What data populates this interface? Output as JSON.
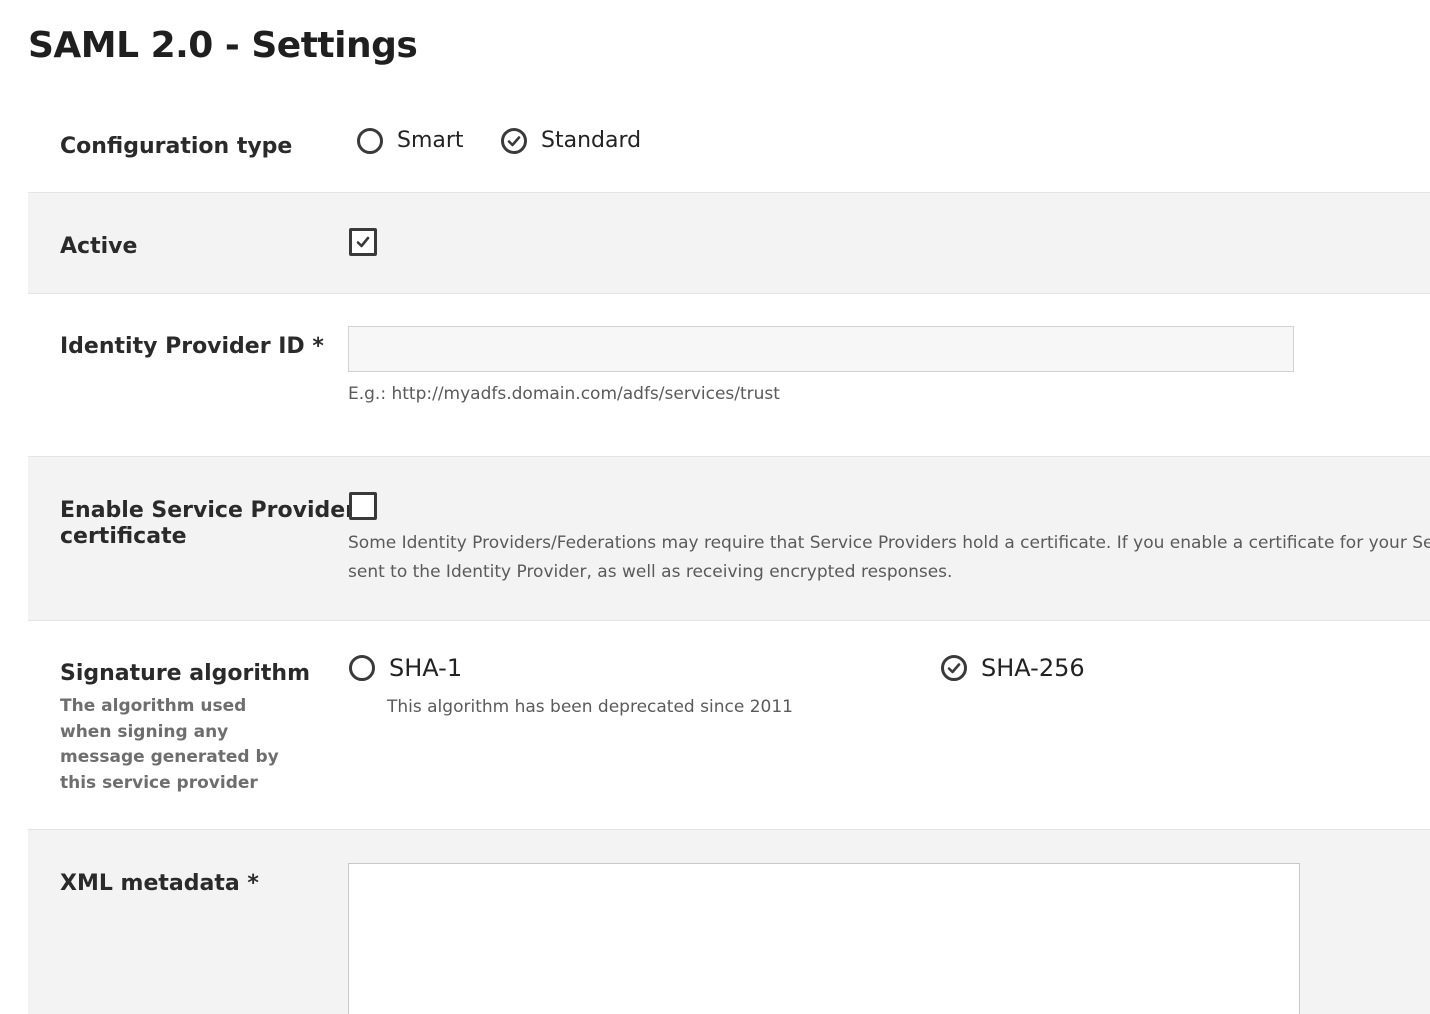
{
  "page": {
    "title": "SAML 2.0 - Settings"
  },
  "config_type": {
    "label": "Configuration type",
    "options": [
      {
        "label": "Smart",
        "checked": false
      },
      {
        "label": "Standard",
        "checked": true
      }
    ]
  },
  "active": {
    "label": "Active",
    "checked": true
  },
  "identity_provider": {
    "label": "Identity Provider ID *",
    "value": "",
    "placeholder": "",
    "hint": "E.g.: http://myadfs.domain.com/adfs/services/trust"
  },
  "sp_certificate": {
    "label_line1": "Enable Service Provider",
    "label_line2": "certificate",
    "checked": false,
    "description_line1": "Some Identity Providers/Federations may require that Service Providers hold a certificate. If you enable a certificate for your Service P",
    "description_line2": "sent to the Identity Provider, as well as receiving encrypted responses."
  },
  "signature": {
    "label": "Signature algorithm",
    "description": "The algorithm used when signing any message generated by this service provider",
    "options": [
      {
        "label": "SHA-1",
        "checked": false,
        "note": "This algorithm has been deprecated since 2011"
      },
      {
        "label": "SHA-256",
        "checked": true
      }
    ]
  },
  "xml_metadata": {
    "label": "XML metadata *",
    "value": ""
  },
  "colors": {
    "row_gray": "#f3f3f3",
    "border": "#e4e4e4",
    "control": "#3a3a3a"
  }
}
